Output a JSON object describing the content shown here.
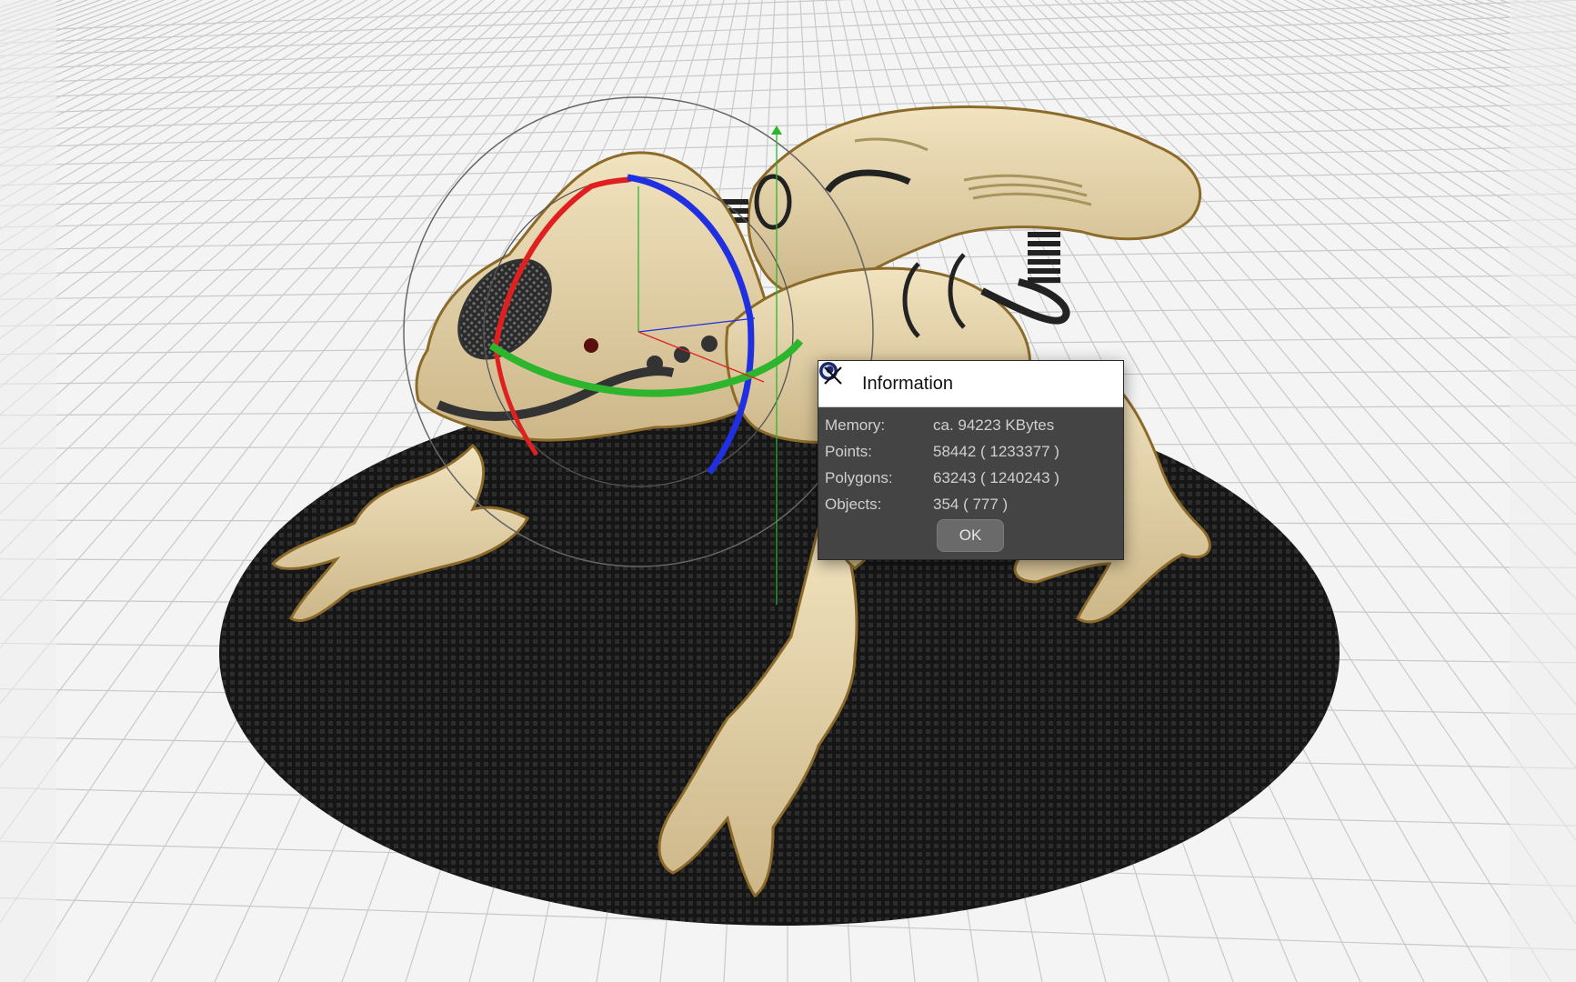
{
  "dialog": {
    "title": "Information",
    "rows": [
      {
        "label": "Memory:",
        "value": "ca. 94223 KBytes"
      },
      {
        "label": "Points:",
        "value": "58442 ( 1233377 )"
      },
      {
        "label": "Polygons:",
        "value": "63243 ( 1240243 )"
      },
      {
        "label": "Objects:",
        "value": "354 ( 777 )"
      }
    ],
    "ok_label": "OK",
    "app_icon": "cinema4d-icon",
    "close_icon": "close-icon"
  },
  "viewport": {
    "grid_color": "#c8c8c8",
    "background": "#f4f4f4",
    "model_color": "#e6d3a6",
    "platform_color": "#141414",
    "axis_colors": {
      "x": "#e02020",
      "y": "#2db52d",
      "z": "#2030e0"
    }
  }
}
